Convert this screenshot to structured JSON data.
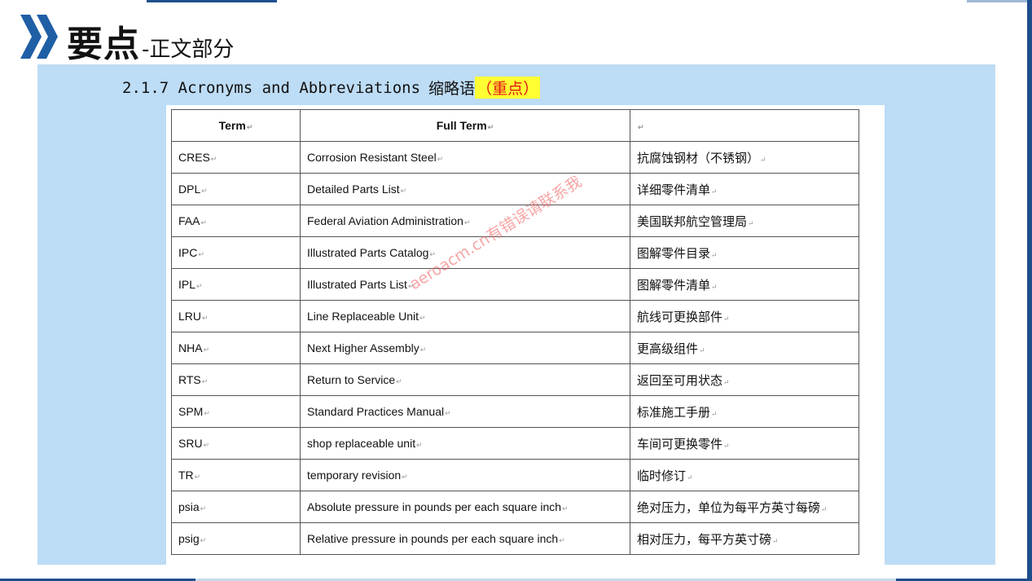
{
  "slide": {
    "title_main": "要点",
    "title_sub": "-正文部分",
    "chevron_icon": "double-chevron-right-icon",
    "accent_color": "#1f5fa6"
  },
  "section": {
    "code": "2.1.7 Acronyms and Abbreviations",
    "cn": "缩略语",
    "highlight": "（重点）",
    "highlight_color": "#e21414",
    "highlight_bg": "#ffff33"
  },
  "table": {
    "headers": [
      "Term",
      "Full Term",
      ""
    ],
    "rows": [
      [
        "CRES",
        "Corrosion Resistant Steel",
        "抗腐蚀钢材（不锈钢）"
      ],
      [
        "DPL",
        "Detailed Parts List",
        "详细零件清单"
      ],
      [
        "FAA",
        "Federal Aviation Administration",
        "美国联邦航空管理局"
      ],
      [
        "IPC",
        "Illustrated Parts Catalog",
        "图解零件目录"
      ],
      [
        "IPL",
        "Illustrated Parts List",
        "图解零件清单"
      ],
      [
        "LRU",
        "Line Replaceable Unit",
        "航线可更换部件"
      ],
      [
        "NHA",
        "Next Higher Assembly",
        "更高级组件"
      ],
      [
        "RTS",
        "Return to Service",
        "返回至可用状态"
      ],
      [
        "SPM",
        "Standard Practices Manual",
        "标准施工手册"
      ],
      [
        "SRU",
        "shop replaceable unit",
        "车间可更换零件"
      ],
      [
        "TR",
        "temporary revision",
        "临时修订"
      ],
      [
        "psia",
        "Absolute pressure in pounds per each square inch",
        "绝对压力，单位为每平方英寸每磅"
      ],
      [
        "psig",
        "Relative pressure in pounds per each square inch",
        "相对压力，每平方英寸磅"
      ]
    ]
  },
  "watermark": "aeroacm.cn有错误请联系我"
}
